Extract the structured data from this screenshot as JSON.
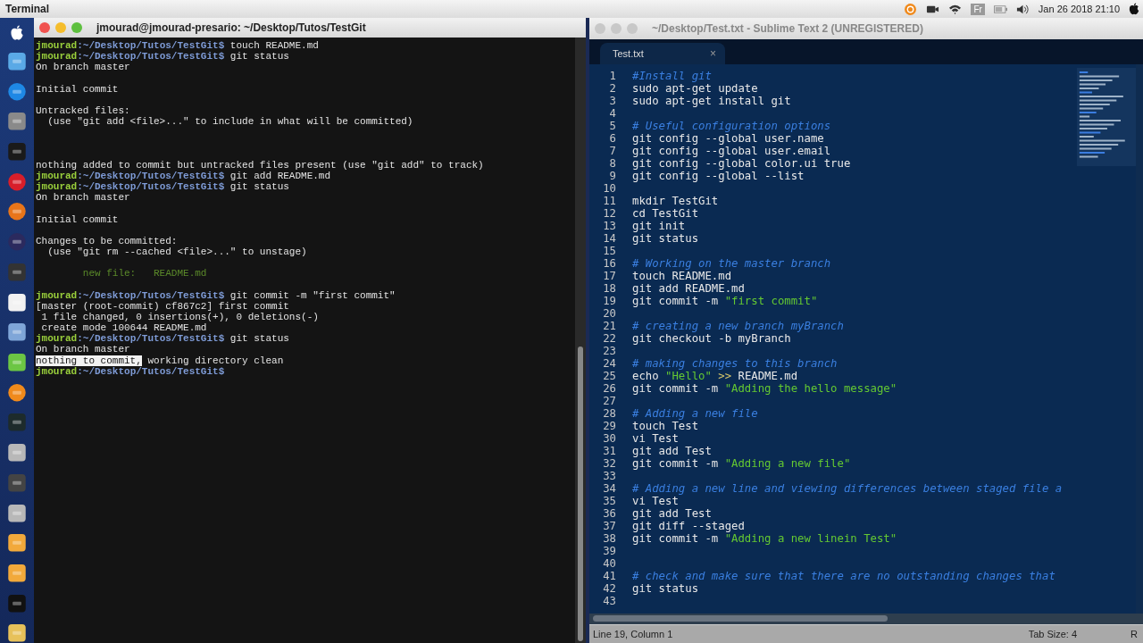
{
  "menubar": {
    "app_name": "Terminal",
    "keyboard_layout": "Fr",
    "clock": "Jan 26 2018 21:10"
  },
  "terminal": {
    "title": "jmourad@jmourad-presario: ~/Desktop/Tutos/TestGit",
    "active": true,
    "lines": [
      {
        "kind": "prompt",
        "user": "jmourad",
        "path": ":~/Desktop/Tutos/TestGit$",
        "command": "touch README.md"
      },
      {
        "kind": "prompt",
        "user": "jmourad",
        "path": ":~/Desktop/Tutos/TestGit$",
        "command": "git status"
      },
      {
        "kind": "output",
        "text": "On branch master"
      },
      {
        "kind": "blank"
      },
      {
        "kind": "output",
        "text": "Initial commit"
      },
      {
        "kind": "blank"
      },
      {
        "kind": "output",
        "text": "Untracked files:"
      },
      {
        "kind": "output",
        "text": "  (use \"git add <file>...\" to include in what will be committed)"
      },
      {
        "kind": "blank"
      },
      {
        "kind": "blank"
      },
      {
        "kind": "blank"
      },
      {
        "kind": "output",
        "text": "nothing added to commit but untracked files present (use \"git add\" to track)"
      },
      {
        "kind": "prompt",
        "user": "jmourad",
        "path": ":~/Desktop/Tutos/TestGit$",
        "command": "git add README.md"
      },
      {
        "kind": "prompt",
        "user": "jmourad",
        "path": ":~/Desktop/Tutos/TestGit$",
        "command": "git status"
      },
      {
        "kind": "output",
        "text": "On branch master"
      },
      {
        "kind": "blank"
      },
      {
        "kind": "output",
        "text": "Initial commit"
      },
      {
        "kind": "blank"
      },
      {
        "kind": "output",
        "text": "Changes to be committed:"
      },
      {
        "kind": "output",
        "text": "  (use \"git rm --cached <file>...\" to unstage)"
      },
      {
        "kind": "blank"
      },
      {
        "kind": "staged",
        "text": "        new file:   README.md"
      },
      {
        "kind": "blank"
      },
      {
        "kind": "prompt",
        "user": "jmourad",
        "path": ":~/Desktop/Tutos/TestGit$",
        "command": "git commit -m \"first commit\""
      },
      {
        "kind": "output",
        "text": "[master (root-commit) cf867c2] first commit"
      },
      {
        "kind": "output",
        "text": " 1 file changed, 0 insertions(+), 0 deletions(-)"
      },
      {
        "kind": "output",
        "text": " create mode 100644 README.md"
      },
      {
        "kind": "prompt",
        "user": "jmourad",
        "path": ":~/Desktop/Tutos/TestGit$",
        "command": "git status"
      },
      {
        "kind": "output",
        "text": "On branch master"
      },
      {
        "kind": "selection",
        "parts": [
          {
            "text": "nothing to commit,",
            "selected": true
          },
          {
            "text": " working directory clean",
            "selected": false
          }
        ]
      },
      {
        "kind": "prompt",
        "user": "jmourad",
        "path": ":~/Desktop/Tutos/TestGit$"
      }
    ]
  },
  "editor": {
    "title": "~/Desktop/Test.txt - Sublime Text 2 (UNREGISTERED)",
    "active": false,
    "tabs": [
      {
        "label": "Test.txt",
        "close": "×",
        "selected": true
      }
    ],
    "lines": [
      {
        "number": "1",
        "parts": [
          {
            "kind": "comment",
            "text": "#Install git"
          }
        ]
      },
      {
        "number": "2",
        "parts": [
          {
            "kind": "plain",
            "text": "sudo apt-get update"
          }
        ]
      },
      {
        "number": "3",
        "parts": [
          {
            "kind": "plain",
            "text": "sudo apt-get install git"
          }
        ]
      },
      {
        "number": "4"
      },
      {
        "number": "5",
        "parts": [
          {
            "kind": "comment",
            "text": "# Useful configuration options"
          }
        ]
      },
      {
        "number": "6",
        "parts": [
          {
            "kind": "plain",
            "text": "git config --global user.name"
          }
        ]
      },
      {
        "number": "7",
        "parts": [
          {
            "kind": "plain",
            "text": "git config --global user.email"
          }
        ]
      },
      {
        "number": "8",
        "parts": [
          {
            "kind": "plain",
            "text": "git config --global color.ui true"
          }
        ]
      },
      {
        "number": "9",
        "parts": [
          {
            "kind": "plain",
            "text": "git config --global --list"
          }
        ]
      },
      {
        "number": "10"
      },
      {
        "number": "11",
        "parts": [
          {
            "kind": "plain",
            "text": "mkdir TestGit"
          }
        ]
      },
      {
        "number": "12",
        "parts": [
          {
            "kind": "plain",
            "text": "cd TestGit"
          }
        ]
      },
      {
        "number": "13",
        "parts": [
          {
            "kind": "plain",
            "text": "git init"
          }
        ]
      },
      {
        "number": "14",
        "parts": [
          {
            "kind": "plain",
            "text": "git status"
          }
        ]
      },
      {
        "number": "15"
      },
      {
        "number": "16",
        "parts": [
          {
            "kind": "comment",
            "text": "# Working on the master branch"
          }
        ]
      },
      {
        "number": "17",
        "parts": [
          {
            "kind": "plain",
            "text": "touch README.md"
          }
        ]
      },
      {
        "number": "18",
        "parts": [
          {
            "kind": "plain",
            "text": "git add README.md"
          }
        ]
      },
      {
        "number": "19",
        "parts": [
          {
            "kind": "plain",
            "text": "git commit -m "
          },
          {
            "kind": "string",
            "text": "\"first commit\""
          }
        ]
      },
      {
        "number": "20"
      },
      {
        "number": "21",
        "parts": [
          {
            "kind": "comment",
            "text": "# creating a new branch myBranch"
          }
        ]
      },
      {
        "number": "22",
        "parts": [
          {
            "kind": "plain",
            "text": "git checkout -b myBranch"
          }
        ]
      },
      {
        "number": "23"
      },
      {
        "number": "24",
        "parts": [
          {
            "kind": "comment",
            "text": "# making changes to this branch"
          }
        ]
      },
      {
        "number": "25",
        "parts": [
          {
            "kind": "plain",
            "text": "echo "
          },
          {
            "kind": "string",
            "text": "\"Hello\""
          },
          {
            "kind": "operator",
            "text": " >>"
          },
          {
            "kind": "plain",
            "text": " README.md"
          }
        ]
      },
      {
        "number": "26",
        "parts": [
          {
            "kind": "plain",
            "text": "git commit -m "
          },
          {
            "kind": "string",
            "text": "\"Adding the hello message\""
          }
        ]
      },
      {
        "number": "27"
      },
      {
        "number": "28",
        "parts": [
          {
            "kind": "comment",
            "text": "# Adding a new file"
          }
        ]
      },
      {
        "number": "29",
        "parts": [
          {
            "kind": "plain",
            "text": "touch Test"
          }
        ]
      },
      {
        "number": "30",
        "parts": [
          {
            "kind": "plain",
            "text": "vi Test"
          }
        ]
      },
      {
        "number": "31",
        "parts": [
          {
            "kind": "plain",
            "text": "git add Test"
          }
        ]
      },
      {
        "number": "32",
        "parts": [
          {
            "kind": "plain",
            "text": "git commit -m "
          },
          {
            "kind": "string",
            "text": "\"Adding a new file\""
          }
        ]
      },
      {
        "number": "33"
      },
      {
        "number": "34",
        "parts": [
          {
            "kind": "comment",
            "text": "# Adding a new line and viewing differences between staged file a"
          }
        ]
      },
      {
        "number": "35",
        "parts": [
          {
            "kind": "plain",
            "text": "vi Test"
          }
        ]
      },
      {
        "number": "36",
        "parts": [
          {
            "kind": "plain",
            "text": "git add Test"
          }
        ]
      },
      {
        "number": "37",
        "parts": [
          {
            "kind": "plain",
            "text": "git diff --staged"
          }
        ]
      },
      {
        "number": "38",
        "parts": [
          {
            "kind": "plain",
            "text": "git commit -m "
          },
          {
            "kind": "string",
            "text": "\"Adding a new linein Test\""
          }
        ]
      },
      {
        "number": "39"
      },
      {
        "number": "40"
      },
      {
        "number": "41",
        "parts": [
          {
            "kind": "comment",
            "text": "# check and make sure that there are no outstanding changes that"
          }
        ]
      },
      {
        "number": "42",
        "parts": [
          {
            "kind": "plain",
            "text": "git status"
          }
        ]
      },
      {
        "number": "43"
      }
    ],
    "status": {
      "position": "Line 19, Column 1",
      "tab_size": "Tab Size: 4",
      "syntax": "R"
    }
  }
}
